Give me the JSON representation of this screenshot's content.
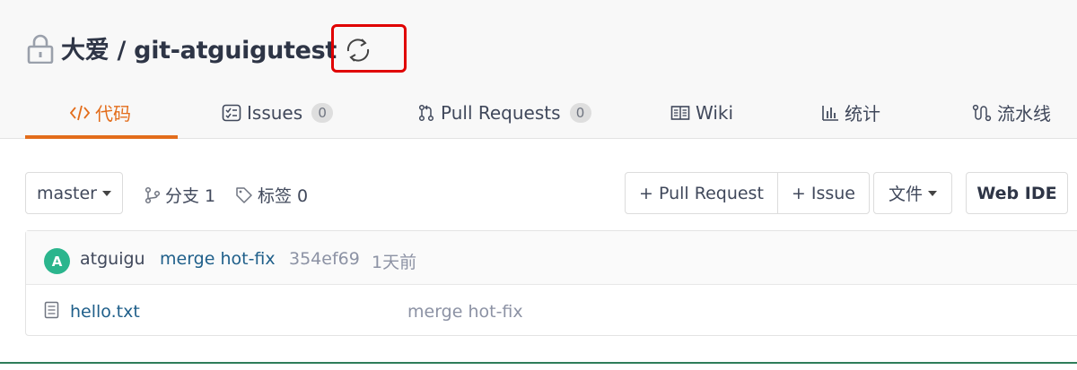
{
  "repo": {
    "owner": "大爱",
    "separator": "/",
    "name": "git-atguigutest",
    "title": "大爱 / git-atguigutest"
  },
  "tabs": [
    {
      "label": "代码",
      "icon": "code-icon",
      "active": true
    },
    {
      "label": "Issues",
      "icon": "issues-icon",
      "count": "0"
    },
    {
      "label": "Pull Requests",
      "icon": "pull-request-icon",
      "count": "0"
    },
    {
      "label": "Wiki",
      "icon": "wiki-book-icon"
    },
    {
      "label": "统计",
      "icon": "bar-chart-icon"
    },
    {
      "label": "流水线",
      "icon": "pipeline-icon"
    }
  ],
  "toolbar": {
    "branch": "master",
    "branches_label": "分支 1",
    "tags_label": "标签 0",
    "new_pr_label": "+ Pull Request",
    "new_issue_label": "+ Issue",
    "file_menu_label": "文件",
    "web_ide_label": "Web IDE"
  },
  "latest_commit": {
    "avatar_letter": "A",
    "author": "atguigu",
    "message": "merge hot-fix",
    "sha": "354ef69",
    "time": "1天前"
  },
  "files": [
    {
      "name": "hello.txt",
      "icon": "file-text-icon",
      "last_commit": "merge hot-fix"
    }
  ],
  "colors": {
    "accent": "#e36d1b",
    "highlight_box": "#e00000",
    "avatar": "#2bb58d",
    "link": "#1f5f8a"
  }
}
